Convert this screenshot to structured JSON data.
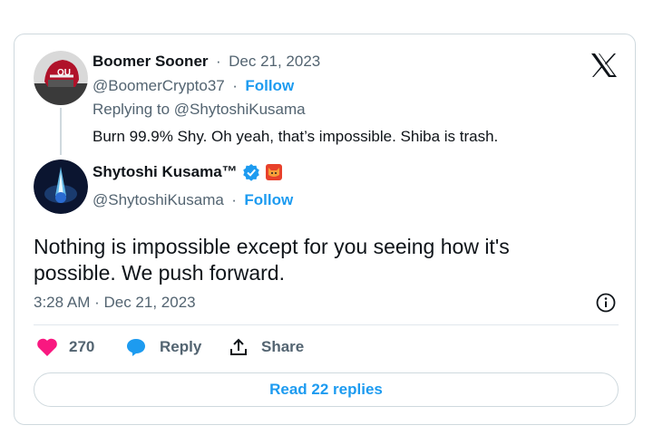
{
  "reply_tweet": {
    "name": "Boomer Sooner",
    "separator": "·",
    "date": "Dec 21, 2023",
    "handle": "@BoomerCrypto37",
    "follow": "Follow",
    "replying_to": "Replying to @ShytoshiKusama",
    "text": "Burn 99.9% Shy. Oh yeah, that’s impossible. Shiba is trash."
  },
  "main_tweet": {
    "name": "Shytoshi Kusama™",
    "handle": "@ShytoshiKusama",
    "separator": "·",
    "follow": "Follow",
    "text": "Nothing is impossible except for you seeing how it's possible. We push forward.",
    "timestamp": "3:28 AM · Dec 21, 2023"
  },
  "actions": {
    "likes": "270",
    "reply": "Reply",
    "share": "Share"
  },
  "read_replies": "Read 22 replies",
  "colors": {
    "accent": "#1d9bf0",
    "like": "#f91880",
    "muted": "#536471",
    "border": "#cfd9de"
  }
}
